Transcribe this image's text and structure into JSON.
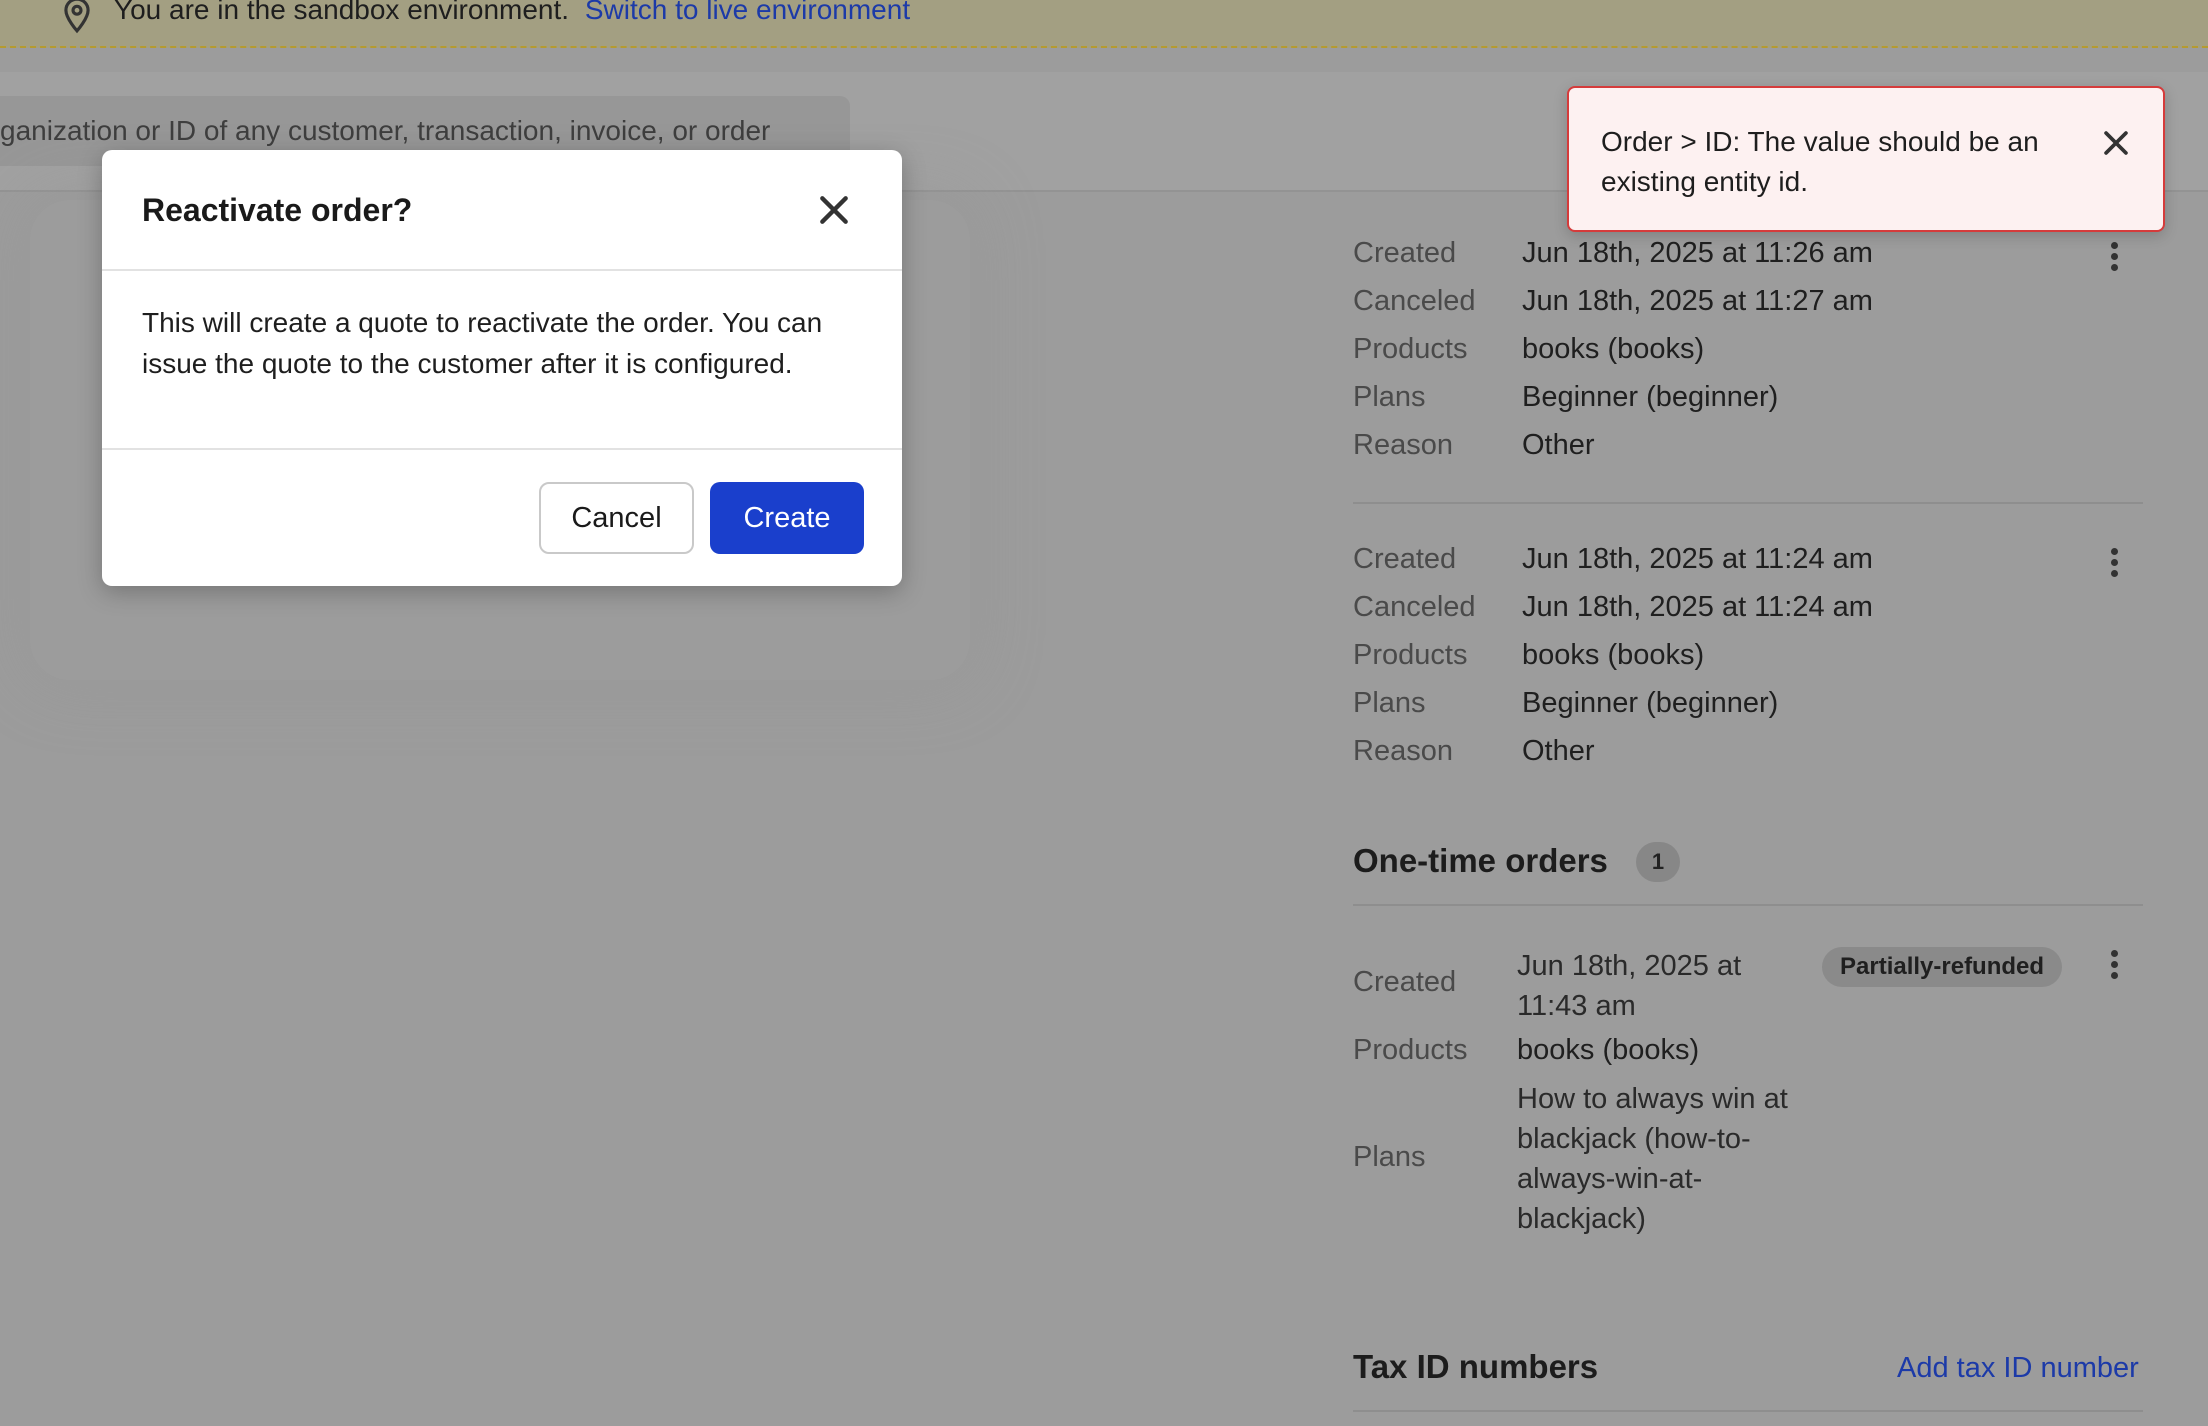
{
  "banner": {
    "text": "You are in the sandbox environment.",
    "link": "Switch to live environment"
  },
  "search": {
    "placeholder": "ganization or ID of any customer, transaction, invoice, or order"
  },
  "subscriptions": [
    {
      "fields": [
        {
          "label": "Created",
          "value": "Jun 18th, 2025 at 11:26 am"
        },
        {
          "label": "Canceled",
          "value": "Jun 18th, 2025 at 11:27 am"
        },
        {
          "label": "Products",
          "value": "books (books)"
        },
        {
          "label": "Plans",
          "value": "Beginner (beginner)"
        },
        {
          "label": "Reason",
          "value": "Other"
        }
      ]
    },
    {
      "fields": [
        {
          "label": "Created",
          "value": "Jun 18th, 2025 at 11:24 am"
        },
        {
          "label": "Canceled",
          "value": "Jun 18th, 2025 at 11:24 am"
        },
        {
          "label": "Products",
          "value": "books (books)"
        },
        {
          "label": "Plans",
          "value": "Beginner (beginner)"
        },
        {
          "label": "Reason",
          "value": "Other"
        }
      ]
    }
  ],
  "one_time_orders": {
    "title": "One-time orders",
    "count": "1",
    "order": {
      "created_label": "Created",
      "created_line1": "Jun 18th, 2025 at",
      "created_line2": "11:43 am",
      "status": "Partially-refunded",
      "products_label": "Products",
      "products_value": "books (books)",
      "plans_label": "Plans",
      "plans_lines": [
        "How to always win at",
        "blackjack (how-to-",
        "always-win-at-",
        "blackjack)"
      ]
    }
  },
  "tax_ids": {
    "title": "Tax ID numbers",
    "add_link": "Add tax ID number"
  },
  "modal": {
    "title": "Reactivate order?",
    "body": "This will create a quote to reactivate the order. You can issue the quote to the customer after it is configured.",
    "cancel": "Cancel",
    "create": "Create"
  },
  "toast": {
    "message": "Order > ID: The value should be an existing entity id."
  },
  "colors": {
    "primary": "#1a3fcc",
    "link": "#1c3aa8",
    "toast_border": "#d53b3b",
    "toast_bg": "#fdf1f1"
  }
}
